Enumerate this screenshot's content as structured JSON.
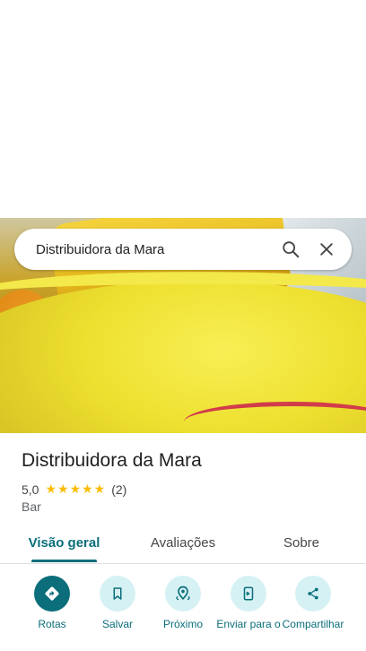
{
  "search": {
    "query": "Distribuidora da Mara"
  },
  "place": {
    "name": "Distribuidora da Mara",
    "rating": "5,0",
    "stars": "★★★★★",
    "review_count": "(2)",
    "category": "Bar"
  },
  "tabs": [
    {
      "label": "Visão geral",
      "active": true
    },
    {
      "label": "Avaliações",
      "active": false
    },
    {
      "label": "Sobre",
      "active": false
    }
  ],
  "actions": [
    {
      "label": "Rotas",
      "icon": "directions-icon"
    },
    {
      "label": "Salvar",
      "icon": "bookmark-icon"
    },
    {
      "label": "Próximo",
      "icon": "nearby-icon"
    },
    {
      "label": "Enviar para o",
      "icon": "send-to-phone-icon"
    },
    {
      "label": "Compartilhar",
      "icon": "share-icon"
    }
  ],
  "colors": {
    "accent": "#0b6e7a",
    "action_bg": "#d5f1f4",
    "star": "#fbbc04"
  }
}
